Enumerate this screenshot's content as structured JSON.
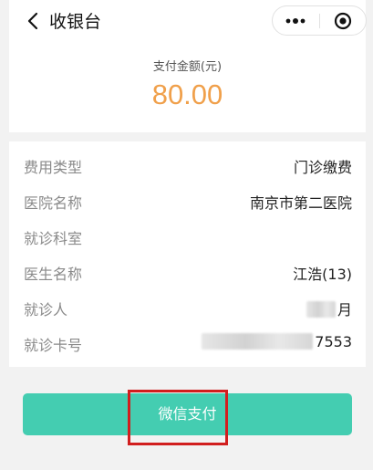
{
  "nav": {
    "title": "收银台"
  },
  "payment": {
    "amount_label": "支付金额(元)",
    "amount": "80.00"
  },
  "details": [
    {
      "label": "费用类型",
      "value": "门诊缴费"
    },
    {
      "label": "医院名称",
      "value": "南京市第二医院"
    },
    {
      "label": "就诊科室",
      "value": ""
    },
    {
      "label": "医生名称",
      "value": "江浩(13)"
    },
    {
      "label": "就诊人",
      "value": "月"
    },
    {
      "label": "就诊卡号",
      "value": "7553"
    }
  ],
  "actions": {
    "pay_label": "微信支付"
  },
  "colors": {
    "amount": "#f0a04b",
    "button": "#44cdb1",
    "highlight": "#d11e1e"
  },
  "icons": {
    "back": "chevron-left-icon",
    "more": "more-dots-icon",
    "close": "target-close-icon"
  }
}
